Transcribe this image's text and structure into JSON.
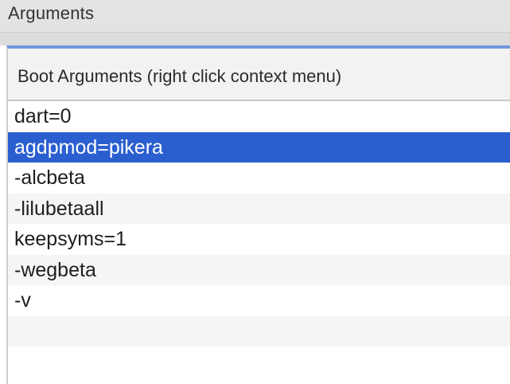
{
  "section": {
    "title": "Arguments"
  },
  "table": {
    "header": "Boot Arguments (right click context menu)",
    "rows": [
      {
        "text": "dart=0"
      },
      {
        "text": "agdpmod=pikera"
      },
      {
        "text": "-alcbeta"
      },
      {
        "text": "-lilubetaall"
      },
      {
        "text": "keepsyms=1"
      },
      {
        "text": "-wegbeta"
      },
      {
        "text": "-v"
      }
    ],
    "selected_index": 1
  },
  "colors": {
    "selection": "#2b5fd0",
    "accent_border": "#6f97dc"
  }
}
